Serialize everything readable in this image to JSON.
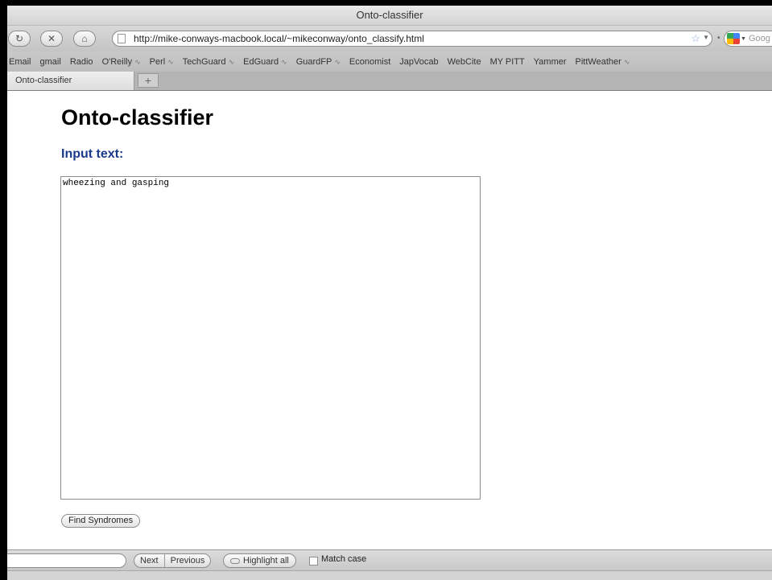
{
  "window": {
    "title": "Onto-classifier"
  },
  "navbar": {
    "reload_icon": "reload-icon",
    "stop_icon": "stop-icon",
    "home_icon": "home-icon",
    "url": "http://mike-conways-macbook.local/~mikeconway/onto_classify.html",
    "search_placeholder": "Goog"
  },
  "bookmarks": [
    {
      "label": "Email",
      "rss": false
    },
    {
      "label": "gmail",
      "rss": false
    },
    {
      "label": "Radio",
      "rss": false
    },
    {
      "label": "O'Reilly",
      "rss": true
    },
    {
      "label": "Perl",
      "rss": true
    },
    {
      "label": "TechGuard",
      "rss": true
    },
    {
      "label": "EdGuard",
      "rss": true
    },
    {
      "label": "GuardFP",
      "rss": true
    },
    {
      "label": "Economist",
      "rss": false
    },
    {
      "label": "JapVocab",
      "rss": false
    },
    {
      "label": "WebCite",
      "rss": false
    },
    {
      "label": "MY PITT",
      "rss": false
    },
    {
      "label": "Yammer",
      "rss": false
    },
    {
      "label": "PittWeather",
      "rss": true
    }
  ],
  "tabs": {
    "active_label": "Onto-classifier",
    "new_tab_label": "+"
  },
  "page": {
    "heading": "Onto-classifier",
    "subheading": "Input text:",
    "input_value": "wheezing and gasping",
    "button_label": "Find Syndromes"
  },
  "findbar": {
    "search_value": "",
    "next_label": "Next",
    "previous_label": "Previous",
    "highlight_label": "Highlight all",
    "match_case_label": "Match case",
    "match_case_checked": false
  },
  "colors": {
    "subheading": "#1a3a8a"
  }
}
